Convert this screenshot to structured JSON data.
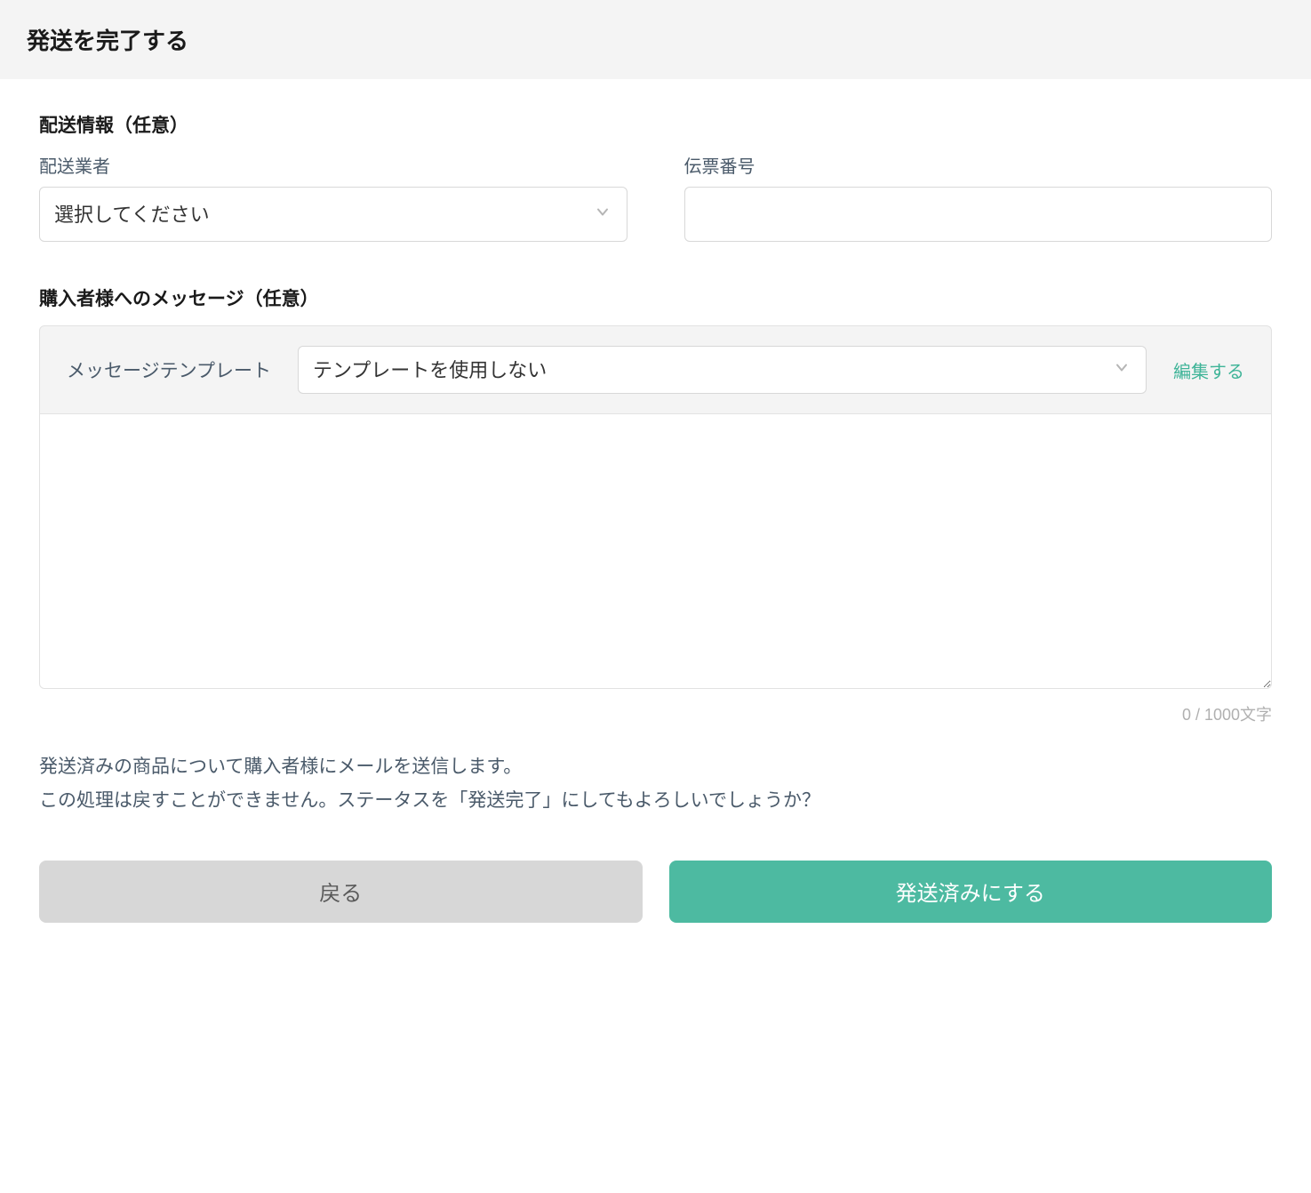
{
  "header": {
    "title": "発送を完了する"
  },
  "shipping": {
    "section_title": "配送情報（任意）",
    "carrier_label": "配送業者",
    "carrier_placeholder": "選択してください",
    "tracking_label": "伝票番号",
    "tracking_value": ""
  },
  "message": {
    "section_title": "購入者様へのメッセージ（任意）",
    "template_label": "メッセージテンプレート",
    "template_selected": "テンプレートを使用しない",
    "edit_link": "編集する",
    "body_value": "",
    "char_count": "0 / 1000文字"
  },
  "confirm": {
    "line1": "発送済みの商品について購入者様にメールを送信します。",
    "line2": "この処理は戻すことができません。ステータスを「発送完了」にしてもよろしいでしょうか？"
  },
  "buttons": {
    "back": "戻る",
    "submit": "発送済みにする"
  }
}
